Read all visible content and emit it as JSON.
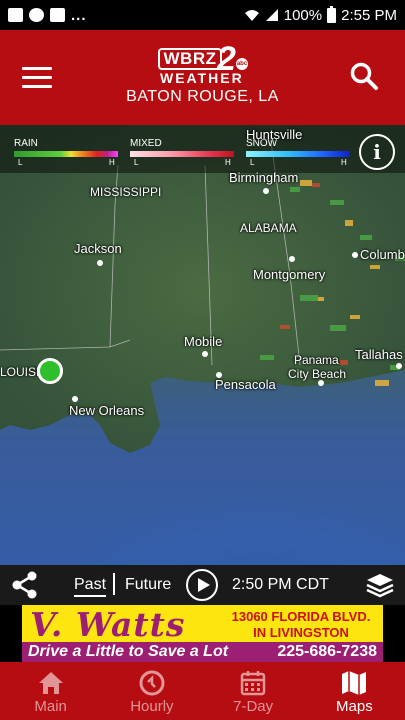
{
  "status_bar": {
    "more": "...",
    "battery": "100%",
    "time": "2:55 PM"
  },
  "header": {
    "logo_call": "WBRZ",
    "logo_channel": "2",
    "logo_network": "abc",
    "logo_weather": "WEATHER",
    "location": "BATON ROUGE, LA"
  },
  "legend": {
    "rain": "RAIN",
    "mixed": "MIXED",
    "snow": "SNOW",
    "low": "L",
    "high": "H",
    "info_glyph": "i"
  },
  "map_labels": {
    "huntsville": "Huntsville",
    "birmingham": "Birmingham",
    "mississippi": "MISSISSIPPI",
    "alabama": "ALABAMA",
    "jackson": "Jackson",
    "columbus": "Columb",
    "montgomery": "Montgomery",
    "mobile": "Mobile",
    "tallahassee": "Tallahas",
    "panama_city_1": "Panama",
    "panama_city_2": "City Beach",
    "louisiana": "LOUISIA",
    "pensacola": "Pensacola",
    "new_orleans": "New Orleans"
  },
  "playback": {
    "past": "Past",
    "future": "Future",
    "time": "2:50 PM CDT"
  },
  "ad": {
    "brand": "V. Watts",
    "address_line1": "13060 FLORIDA BLVD.",
    "address_line2": "IN LIVINGSTON",
    "tagline": "Drive a Little to Save a Lot",
    "phone": "225-686-7238"
  },
  "bottom_nav": [
    {
      "label": "Main",
      "icon": "home-icon",
      "active": false
    },
    {
      "label": "Hourly",
      "icon": "clock-icon",
      "active": false
    },
    {
      "label": "7-Day",
      "icon": "calendar-icon",
      "active": false
    },
    {
      "label": "Maps",
      "icon": "map-icon",
      "active": true
    }
  ],
  "colors": {
    "brand_red": "#b50d12",
    "location_marker": "#2fbf2b",
    "ad_yellow": "#fde510",
    "ad_purple": "#9c1f73"
  }
}
